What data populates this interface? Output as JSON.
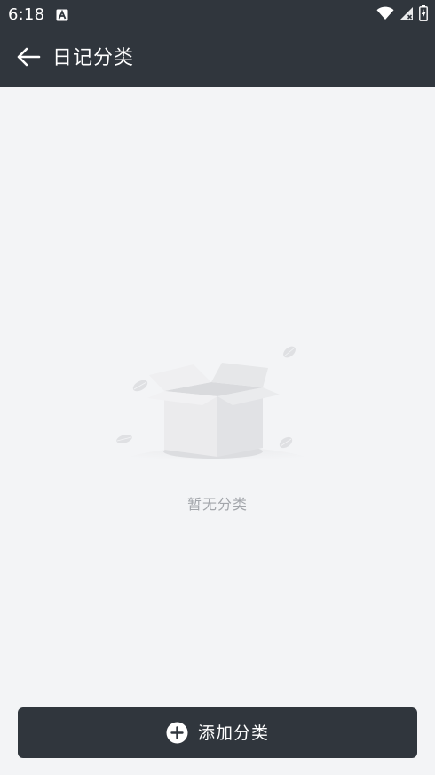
{
  "status_bar": {
    "time": "6:18",
    "app_icon": "accessibility-a-icon",
    "icons": [
      "wifi-icon",
      "signal-no-data-icon",
      "battery-charging-icon"
    ]
  },
  "app_bar": {
    "back_icon": "arrow-left-icon",
    "title": "日记分类"
  },
  "empty_state": {
    "illustration": "empty-box-illustration",
    "message": "暂无分类"
  },
  "add_button": {
    "icon": "plus-circle-icon",
    "label": "添加分类"
  },
  "colors": {
    "header_bg": "#30363d",
    "page_bg": "#f3f4f6",
    "empty_text": "#a3a6ab",
    "button_bg": "#30363d",
    "button_text": "#ffffff"
  }
}
